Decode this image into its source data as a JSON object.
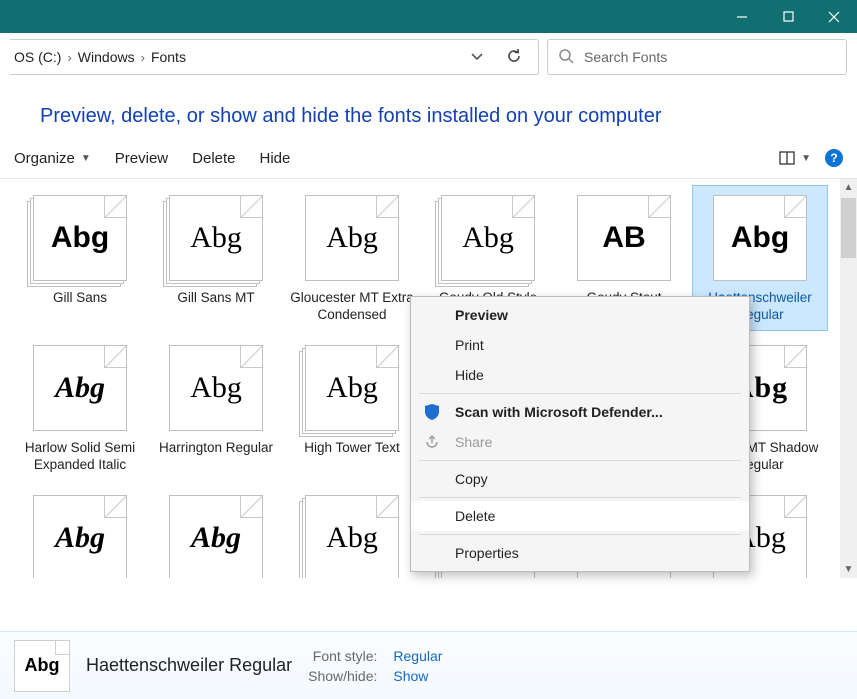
{
  "breadcrumbs": {
    "a": "OS (C:)",
    "b": "Windows",
    "c": "Fonts"
  },
  "search": {
    "placeholder": "Search Fonts"
  },
  "header_msg": "Preview, delete, or show and hide the fonts installed on your computer",
  "toolbar": {
    "organize": "Organize",
    "preview": "Preview",
    "delete": "Delete",
    "hide": "Hide"
  },
  "fonts_row1": [
    {
      "name": "Gill Sans",
      "stack": true,
      "cls": ""
    },
    {
      "name": "Gill Sans MT",
      "stack": true,
      "cls": "serif"
    },
    {
      "name": "Gloucester MT Extra Condensed",
      "stack": false,
      "cls": "serif"
    },
    {
      "name": "Goudy Old Style",
      "stack": true,
      "cls": "serif"
    },
    {
      "name": "Goudy Stout",
      "stack": false,
      "cls": "slab",
      "sample": "AB"
    },
    {
      "name": "Haettenschweiler Regular",
      "stack": false,
      "cls": "slab",
      "selected": true
    }
  ],
  "fonts_row2": [
    {
      "name": "Harlow Solid Semi Expanded Italic",
      "stack": false,
      "cls": "script"
    },
    {
      "name": "Harrington Regular",
      "stack": false,
      "cls": "serif"
    },
    {
      "name": "High Tower Text",
      "stack": true,
      "cls": "serif"
    },
    {
      "name": "",
      "stack": true,
      "cls": "serif"
    },
    {
      "name": "",
      "stack": true,
      "cls": "serif"
    },
    {
      "name": "Imprint MT Shadow Regular",
      "stack": false,
      "cls": "engraved"
    }
  ],
  "fonts_row3": [
    {
      "name": "",
      "stack": false,
      "cls": "script"
    },
    {
      "name": "",
      "stack": false,
      "cls": "script"
    },
    {
      "name": "",
      "stack": true,
      "cls": "serif"
    },
    {
      "name": "",
      "stack": true,
      "cls": "slab"
    },
    {
      "name": "",
      "stack": false,
      "cls": "serif"
    },
    {
      "name": "",
      "stack": false,
      "cls": "serif"
    }
  ],
  "sample_default": "Abg",
  "context_menu": {
    "preview": "Preview",
    "print": "Print",
    "hide": "Hide",
    "scan": "Scan with Microsoft Defender...",
    "share": "Share",
    "copy": "Copy",
    "delete": "Delete",
    "properties": "Properties"
  },
  "details": {
    "title": "Haettenschweiler Regular",
    "style_k": "Font style:",
    "style_v": "Regular",
    "show_k": "Show/hide:",
    "show_v": "Show",
    "thumb": "Abg"
  }
}
